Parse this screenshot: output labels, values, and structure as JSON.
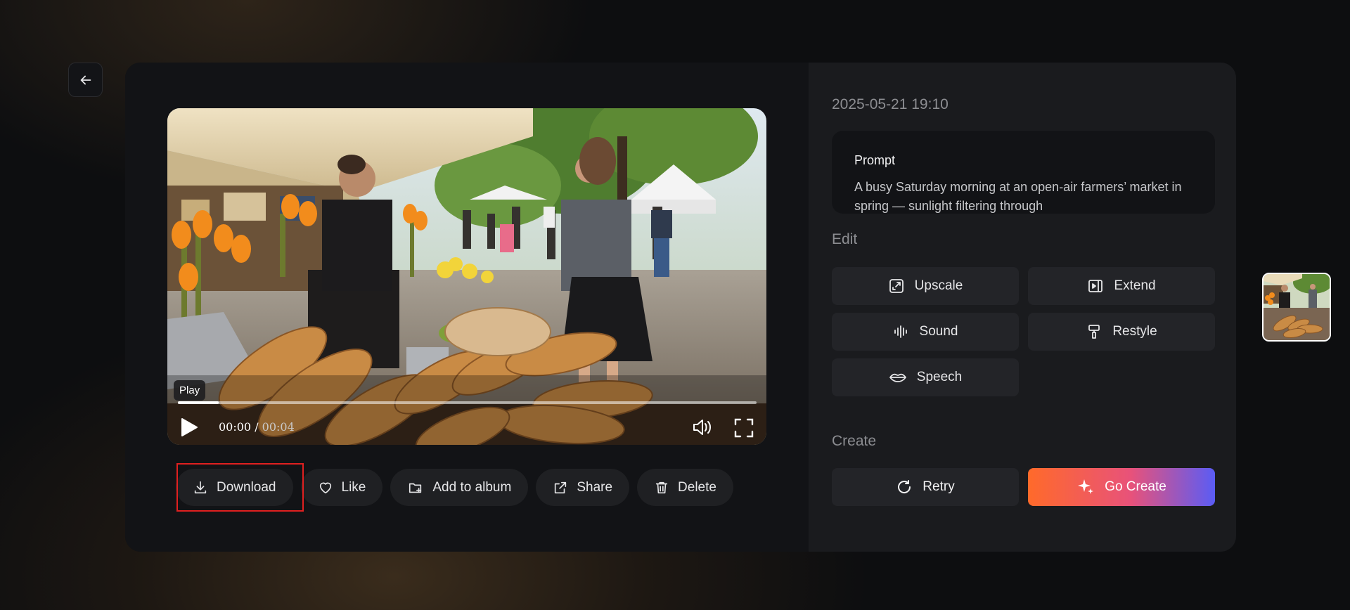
{
  "nav": {
    "back_icon": "arrow-left-icon"
  },
  "player": {
    "tooltip": "Play",
    "current_time": "00:00",
    "separator": " / ",
    "duration": "00:04",
    "progress": 0.07
  },
  "actions": {
    "download": "Download",
    "like": "Like",
    "add_to_album": "Add to album",
    "share": "Share",
    "delete": "Delete"
  },
  "details": {
    "date": "2025-05-21 19:10",
    "prompt_title": "Prompt",
    "prompt_text": "A busy Saturday morning at an open-air farmers’ market in spring — sunlight filtering through"
  },
  "edit": {
    "label": "Edit",
    "upscale": "Upscale",
    "extend": "Extend",
    "sound": "Sound",
    "restyle": "Restyle",
    "speech": "Speech"
  },
  "create": {
    "label": "Create",
    "retry": "Retry",
    "go_create": "Go Create"
  },
  "colors": {
    "highlight": "#e02020",
    "go_create_start": "#ff6a2a",
    "go_create_end": "#5a5cf5"
  }
}
